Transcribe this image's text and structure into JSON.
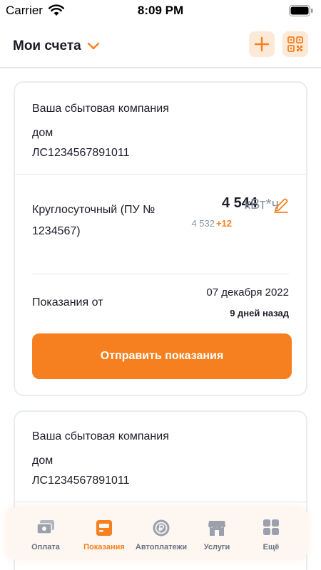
{
  "status_bar": {
    "carrier": "Carrier",
    "time": "8:09 PM"
  },
  "header": {
    "title": "Мои счета"
  },
  "accounts": [
    {
      "company": "Ваша сбытовая компания",
      "object": "дом",
      "account_number": "ЛС1234567891011",
      "meter": {
        "tariff": "Круглосуточный (ПУ № 1234567)",
        "current_value": "4 544",
        "unit": "кВт*ч",
        "previous_value": "4 532",
        "delta": "+12"
      },
      "readings": {
        "label": "Показания от",
        "date": "07 декабря 2022",
        "ago": "9 дней назад"
      },
      "send_button": "Отправить показания"
    },
    {
      "company": "Ваша сбытовая компания",
      "object": "дом",
      "account_number": "ЛС1234567891011"
    }
  ],
  "tabbar": {
    "tabs": [
      {
        "label": "Оплата",
        "icon": "payment-icon",
        "active": false
      },
      {
        "label": "Показания",
        "icon": "readings-icon",
        "active": true
      },
      {
        "label": "Автоплатежи",
        "icon": "autopay-icon",
        "active": false
      },
      {
        "label": "Услуги",
        "icon": "shop-icon",
        "active": false
      },
      {
        "label": "Ещё",
        "icon": "grid-icon",
        "active": false
      }
    ]
  },
  "colors": {
    "accent": "#f6801f",
    "accent_light": "#fde9d8",
    "text": "#1c1c28",
    "muted": "#8b93a1",
    "border": "#e8ecf1"
  }
}
